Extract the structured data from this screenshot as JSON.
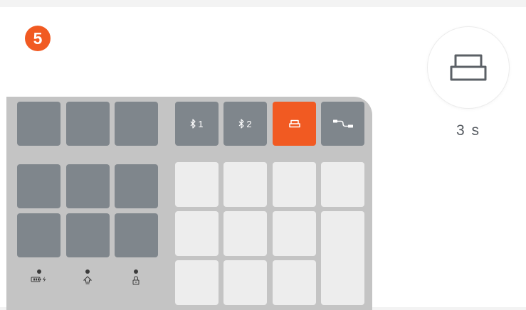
{
  "colors": {
    "accent": "#f15a22",
    "key_dark": "#7f868c",
    "key_light": "#ededed",
    "keyboard_body": "#c4c4c4"
  },
  "step": {
    "number": "5"
  },
  "keyboard": {
    "easy_switch": [
      {
        "icon": "bluetooth-icon",
        "label": "1"
      },
      {
        "icon": "bluetooth-icon",
        "label": "2"
      },
      {
        "icon": "receiver-icon",
        "label": "",
        "active": true
      },
      {
        "icon": "usb-cable-icon",
        "label": ""
      }
    ],
    "indicators": [
      {
        "icon": "battery-charging-icon"
      },
      {
        "icon": "caps-lock-icon"
      },
      {
        "icon": "num-lock-icon"
      }
    ]
  },
  "hold": {
    "icon": "receiver-icon",
    "duration": "3 s"
  }
}
